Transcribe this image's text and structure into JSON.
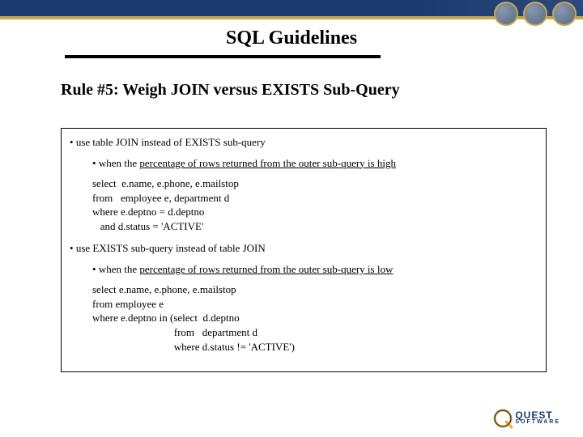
{
  "header": {
    "title": "SQL Guidelines"
  },
  "rule": {
    "heading": "Rule #5: Weigh JOIN versus EXISTS Sub-Query"
  },
  "content": {
    "bullet1": "use table JOIN instead of EXISTS sub-query",
    "sub1_prefix": "when the ",
    "sub1_underline": "percentage of rows returned from the outer sub-query is high",
    "code1": "select  e.name, e.phone, e.mailstop\nfrom   employee e, department d\nwhere e.deptno = d.deptno\n   and d.status = 'ACTIVE'",
    "bullet2": "use EXISTS sub-query instead of table JOIN",
    "sub2_prefix": "when the ",
    "sub2_underline": "percentage of rows returned from the outer sub-query is low",
    "code2": "select e.name, e.phone, e.mailstop\nfrom employee e\nwhere e.deptno in (select  d.deptno\n                               from   department d\n                               where d.status != 'ACTIVE')"
  },
  "footer": {
    "brand": "QUEST",
    "brand_sub": "SOFTWARE"
  }
}
